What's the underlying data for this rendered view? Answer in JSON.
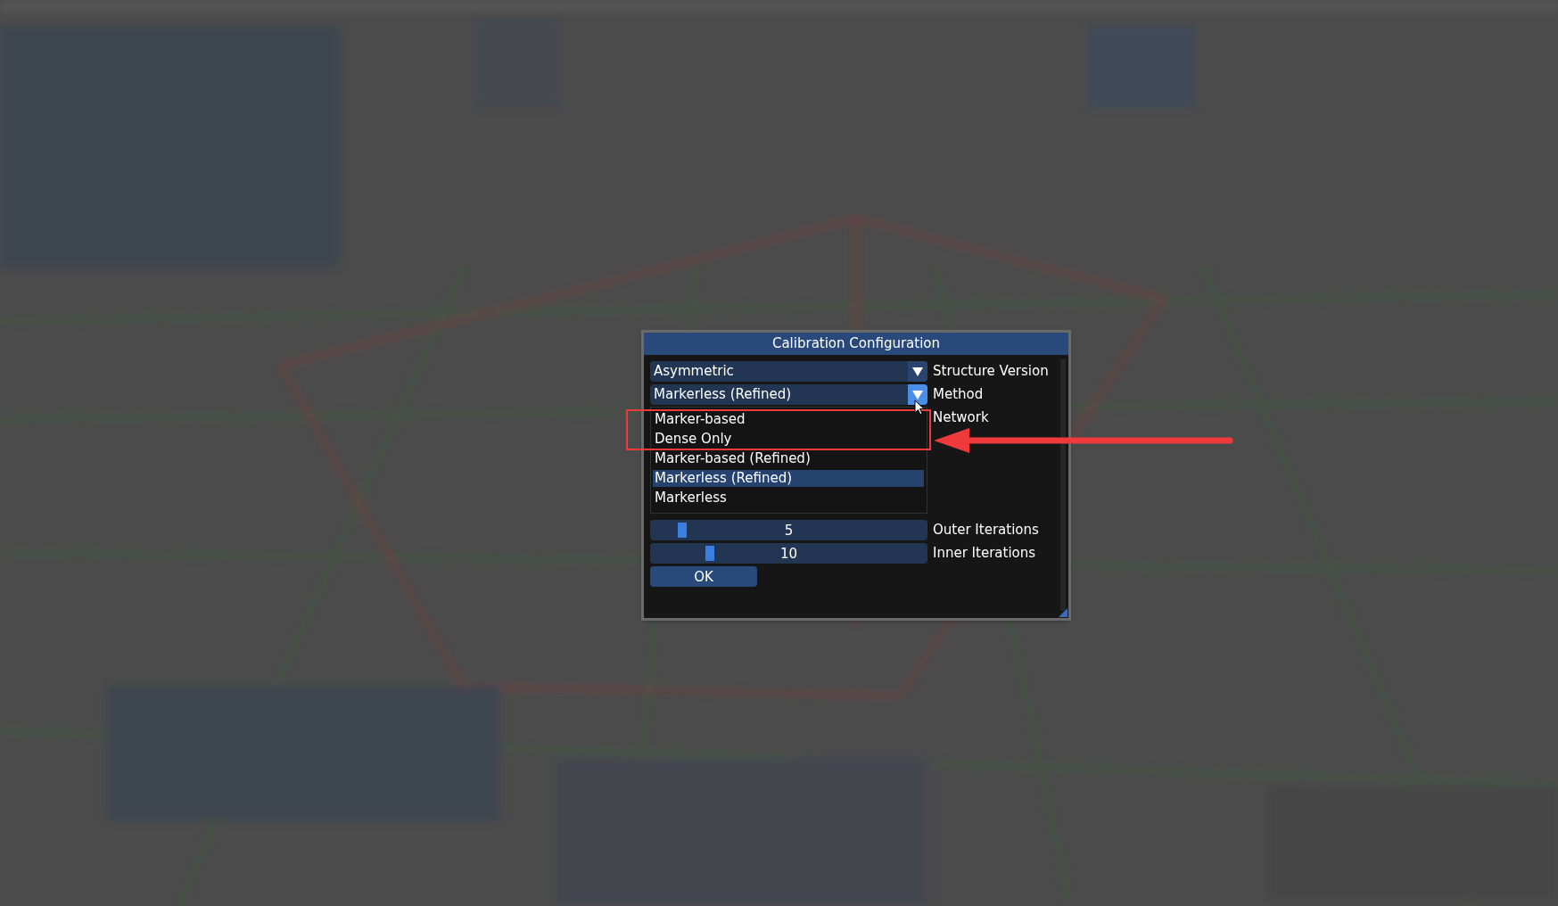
{
  "dialog": {
    "title": "Calibration Configuration",
    "rows": [
      {
        "kind": "combo",
        "value": "Asymmetric",
        "label": "Structure Version",
        "open": false
      },
      {
        "kind": "combo",
        "value": "Markerless (Refined)",
        "label": "Method",
        "open": true
      },
      {
        "kind": "label",
        "label": "Network"
      },
      {
        "kind": "slider",
        "value": "5",
        "level": 0.1,
        "label": "Outer Iterations"
      },
      {
        "kind": "slider",
        "value": "10",
        "level": 0.2,
        "label": "Inner Iterations"
      }
    ],
    "dropdown": {
      "options": [
        {
          "label": "Marker-based",
          "selected": false
        },
        {
          "label": "Dense Only",
          "selected": false
        },
        {
          "label": "Marker-based (Refined)",
          "selected": false
        },
        {
          "label": "Markerless (Refined)",
          "selected": true
        },
        {
          "label": "Markerless",
          "selected": false
        }
      ]
    },
    "ok_button": "OK"
  }
}
